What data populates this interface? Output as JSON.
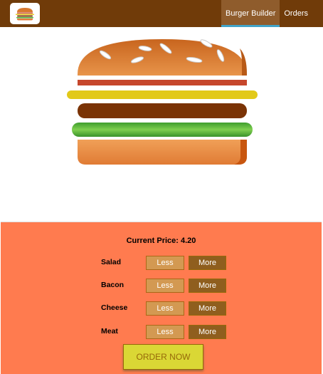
{
  "header": {
    "logo_icon": "burger-logo-icon",
    "nav": [
      {
        "label": "Burger Builder",
        "active": true
      },
      {
        "label": "Orders",
        "active": false
      }
    ]
  },
  "burger": {
    "layers": [
      "bread-top",
      "bacon",
      "cheese",
      "meat",
      "salad",
      "bread-bottom"
    ]
  },
  "controls": {
    "price_label": "Current Price: 4.20",
    "ingredients": [
      {
        "label": "Salad",
        "less": "Less",
        "more": "More"
      },
      {
        "label": "Bacon",
        "less": "Less",
        "more": "More"
      },
      {
        "label": "Cheese",
        "less": "Less",
        "more": "More"
      },
      {
        "label": "Meat",
        "less": "Less",
        "more": "More"
      }
    ],
    "order_label": "ORDER NOW"
  },
  "colors": {
    "toolbar": "#703B09",
    "active_tab": "#8F5C2C",
    "active_underline": "#40A4C8",
    "controls_bg": "#FF7B4F",
    "less_button": "#D39952",
    "more_button": "#8F5E1E",
    "order_button": "#DAD735"
  }
}
